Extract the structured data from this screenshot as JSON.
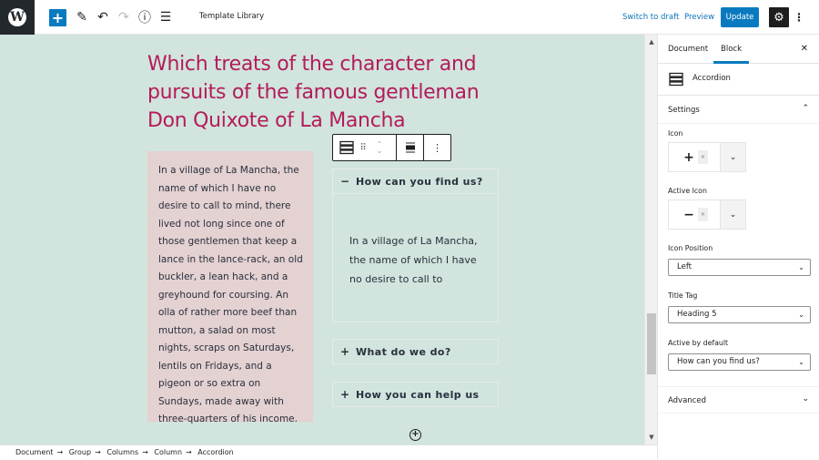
{
  "topbar": {
    "logo_icon": "wordpress-logo-icon",
    "logo_glyph": "W",
    "add_glyph": "+",
    "edit_glyph": "✎",
    "undo_glyph": "↶",
    "redo_glyph": "↷",
    "info_glyph": "ⓘ",
    "outline_glyph": "☰",
    "title": "Template Library",
    "switch_to_draft": "Switch to draft",
    "preview": "Preview",
    "update": "Update",
    "settings_glyph": "⚙",
    "more_glyph": "⋮"
  },
  "content": {
    "heading": "Which treats of the character and pursuits of the famous gentleman Don Quixote of La Mancha",
    "left_paragraph": "In a village of La Mancha, the name of which I have no desire to call to mind, there lived not long since one of those gentlemen that keep a lance in the lance-rack, an old buckler, a lean hack, and a greyhound for coursing. An olla of rather more beef than mutton, a salad on most nights, scraps on Saturdays, lentils on Fridays, and a pigeon or so extra on Sundays, made away with three-quarters of his income.",
    "block_toolbar": {
      "block_icon": "☰",
      "drag_glyph": "⠿",
      "move_up": "⌃",
      "move_down": "⌄",
      "align_glyph": "▬",
      "more_glyph": "⋮"
    },
    "accordion": [
      {
        "title": "How can you find us?",
        "symbol": "−",
        "open": true,
        "body": "In a village of La Mancha, the name of which I have no desire to call to"
      },
      {
        "title": "What do we do?",
        "symbol": "+",
        "open": false
      },
      {
        "title": "How you can help us",
        "symbol": "+",
        "open": false
      }
    ],
    "append_glyph": "+"
  },
  "breadcrumb": [
    "Document",
    "Group",
    "Columns",
    "Column",
    "Accordion"
  ],
  "breadcrumb_sep": "→",
  "sidebar": {
    "tabs": [
      "Document",
      "Block"
    ],
    "active_tab": "Block",
    "close_glyph": "✕",
    "block_name": "Accordion",
    "settings_label": "Settings",
    "icon_label": "Icon",
    "icon_value": "+",
    "active_icon_label": "Active Icon",
    "active_icon_value": "−",
    "remove_glyph": "×",
    "dropdown_glyph": "⌄",
    "icon_position_label": "Icon Position",
    "icon_position_value": "Left",
    "title_tag_label": "Title Tag",
    "title_tag_value": "Heading 5",
    "active_default_label": "Active by default",
    "active_default_value": "How can you find us?",
    "advanced_label": "Advanced",
    "chev_up": "⌃",
    "chev_down": "⌄"
  },
  "colors": {
    "accent": "#0a7ac0",
    "heading": "#b41b5c",
    "canvas_bg": "#d1e4dd",
    "column_bg": "#e4d1d1"
  }
}
